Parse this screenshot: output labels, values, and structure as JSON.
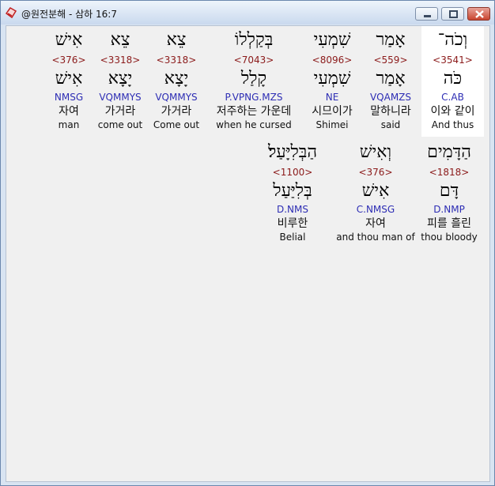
{
  "window": {
    "title": "@원전분해 - 삼하 16:7"
  },
  "row1": [
    {
      "hebrew": "וְכֹה־",
      "strong": "<3541>",
      "lemma": "כֹּה",
      "morph": "C.AB",
      "korean": "이와 같이",
      "english": "And thus"
    },
    {
      "hebrew": "אָמַר",
      "strong": "<559>",
      "lemma": "אָמַר",
      "morph": "VQAMZS",
      "korean": "말하니라",
      "english": "said"
    },
    {
      "hebrew": "שִׁמְעִי",
      "strong": "<8096>",
      "lemma": "שִׁמְעִי",
      "morph": "NE",
      "korean": "시므이가",
      "english": "Shimei"
    },
    {
      "hebrew": "בְּקַלְלוֹ",
      "strong": "<7043>",
      "lemma": "קָלַל",
      "morph": "P.VPNG.MZS",
      "korean": "저주하는 가운데",
      "english": "when he cursed"
    },
    {
      "hebrew": "צֵא",
      "strong": "<3318>",
      "lemma": "יָצָא",
      "morph": "VQMMYS",
      "korean": "가거라",
      "english": "Come out"
    },
    {
      "hebrew": "צֵא",
      "strong": "<3318>",
      "lemma": "יָצָא",
      "morph": "VQMMYS",
      "korean": "가거라",
      "english": "come out"
    },
    {
      "hebrew": "אִישׁ",
      "strong": "<376>",
      "lemma": "אִישׁ",
      "morph": "NMSG",
      "korean": "자여",
      "english": "man"
    }
  ],
  "row2": [
    {
      "hebrew": "הַדָּמִים",
      "strong": "<1818>",
      "lemma": "דָּם",
      "morph": "D.NMP",
      "korean": "피를 흘린",
      "english": "thou bloody"
    },
    {
      "hebrew": "וְאִישׁ",
      "strong": "<376>",
      "lemma": "אִישׁ",
      "morph": "C.NMSG",
      "korean": "자여",
      "english": "and thou man of"
    },
    {
      "hebrew": "הַבְּלִיָּעַל׃",
      "strong": "<1100>",
      "lemma": "בְּלִיַּעַל",
      "morph": "D.NMS",
      "korean": "비루한",
      "english": "Belial"
    }
  ]
}
